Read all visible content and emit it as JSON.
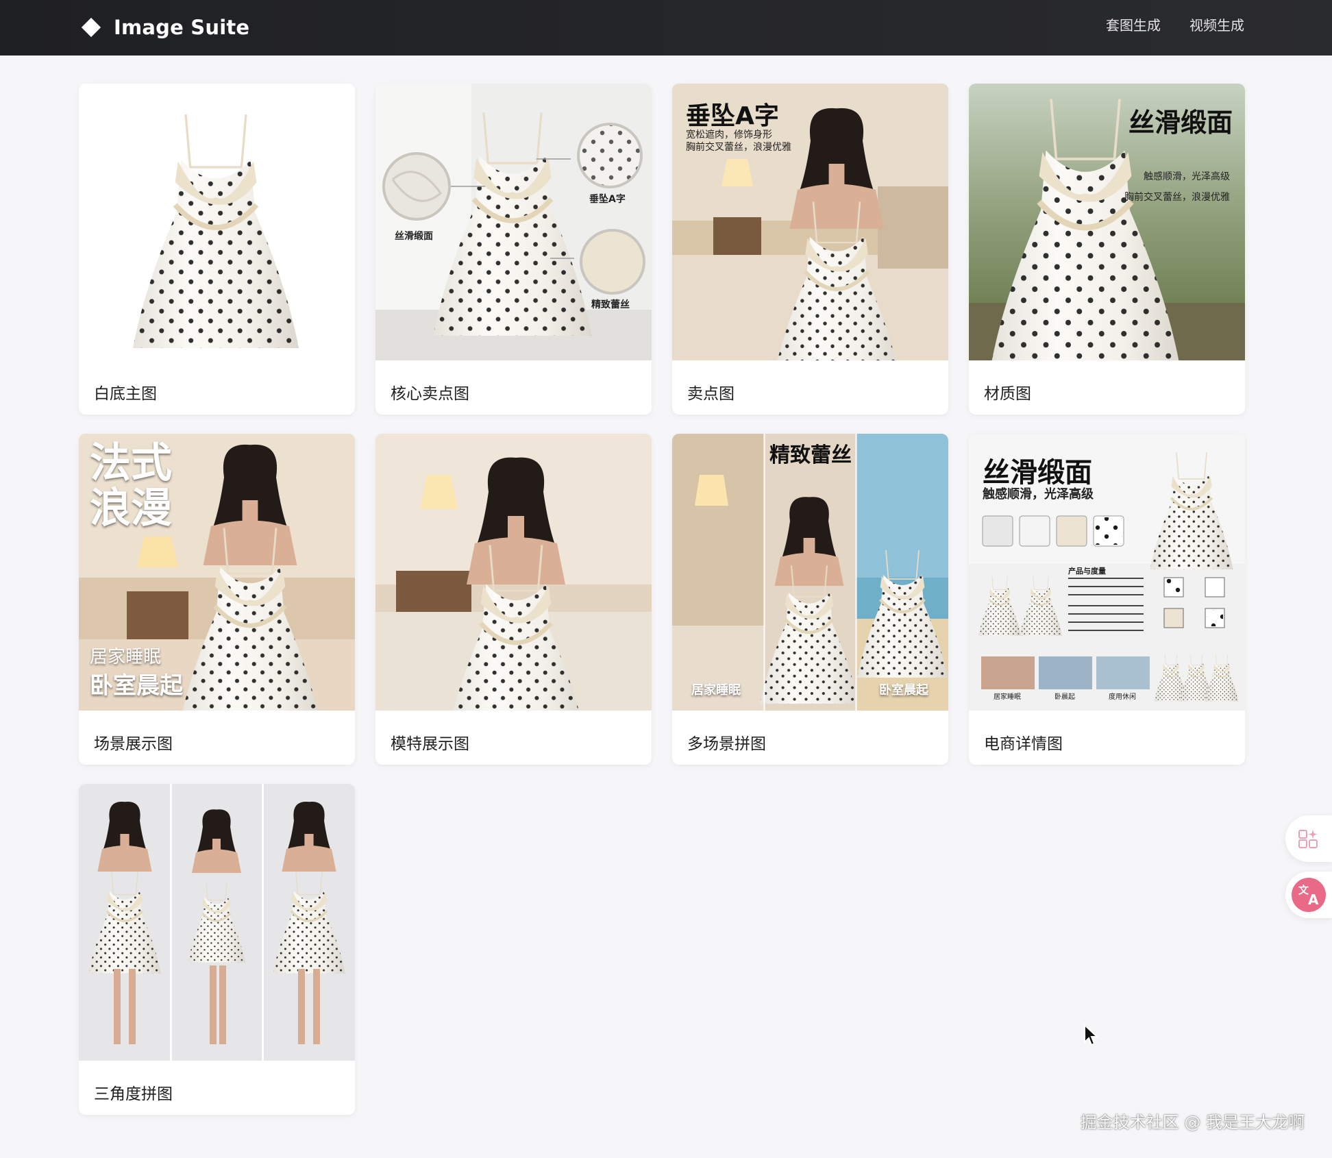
{
  "header": {
    "brand": "Image Suite",
    "nav": [
      "套图生成",
      "视频生成"
    ]
  },
  "cards": [
    {
      "label": "白底主图",
      "overlays": []
    },
    {
      "label": "核心卖点图",
      "overlays": [
        "丝滑缎面",
        "垂坠A字",
        "精致蕾丝"
      ]
    },
    {
      "label": "卖点图",
      "overlays": [
        "垂坠A字",
        "宽松遮肉，修饰身形",
        "胸前交叉蕾丝，浪漫优雅"
      ]
    },
    {
      "label": "材质图",
      "overlays": [
        "丝滑缎面",
        "触感顺滑，光泽高级",
        "胸前交叉蕾丝，浪漫优雅"
      ]
    },
    {
      "label": "场景展示图",
      "overlays": [
        "法式",
        "浪漫",
        "居家睡眠",
        "卧室晨起"
      ]
    },
    {
      "label": "模特展示图",
      "overlays": []
    },
    {
      "label": "多场景拼图",
      "overlays": [
        "精致蕾丝",
        "居家睡眠",
        "卧室晨起"
      ]
    },
    {
      "label": "电商详情图",
      "overlays": [
        "丝滑缎面",
        "触感顺滑，光泽高级",
        "产品与度量",
        "居家睡眠",
        "卧晨起",
        "度用休闲"
      ]
    },
    {
      "label": "三角度拼图",
      "overlays": []
    }
  ],
  "floating": {
    "icons": [
      "ai-grid-icon",
      "translate-icon"
    ]
  },
  "watermark": "掘金技术社区 @ 我是王大龙啊",
  "colors": {
    "topbar": "#1f2023",
    "background": "#f6f6f8",
    "card": "#ffffff",
    "dots": "#1a1a1a",
    "lace": "#e9dcc4"
  }
}
